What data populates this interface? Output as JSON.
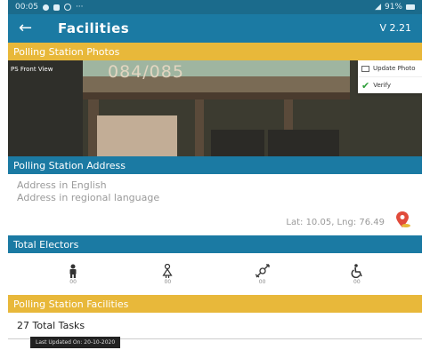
{
  "status_bar": {
    "time": "00:05",
    "battery": "91%"
  },
  "app_bar": {
    "title": "Facilities",
    "version": "V 2.21"
  },
  "photos_section": {
    "header": "Polling Station Photos",
    "photo_label": "PS Front View",
    "photo_number": "084/085",
    "menu": {
      "update_label": "Update Photo",
      "verify_label": "Verify"
    }
  },
  "address_section": {
    "header": "Polling Station Address",
    "english_placeholder": "Address in English",
    "regional_placeholder": "Address in regional language",
    "latlng": "Lat: 10.05, Lng: 76.49"
  },
  "electors_section": {
    "header": "Total Electors",
    "categories": [
      {
        "icon": "male-voter-icon",
        "count": "00"
      },
      {
        "icon": "female-voter-icon",
        "count": "00"
      },
      {
        "icon": "third-gender-icon",
        "count": "00"
      },
      {
        "icon": "disabled-voter-icon",
        "count": "00"
      }
    ]
  },
  "facilities_section": {
    "header": "Polling Station Facilities",
    "tasks": "27 Total Tasks"
  },
  "last_updated": "Last Updated On: 20-10-2020",
  "colors": {
    "primary": "#1b7aa3",
    "accent": "#e8b83a",
    "verify": "#2e9e3a",
    "pin": "#e14b3b"
  }
}
